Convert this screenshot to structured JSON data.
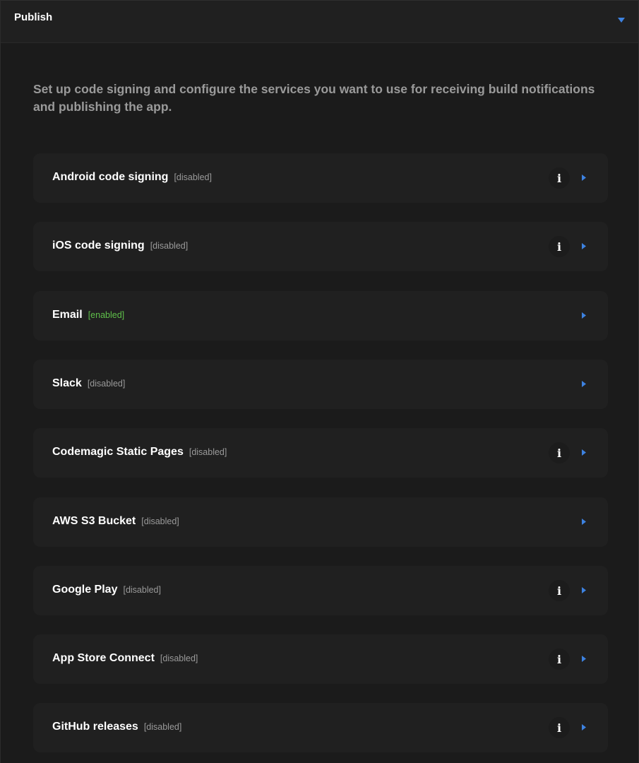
{
  "header": {
    "title": "Publish",
    "toggle_icon": "caret-down-icon",
    "accent_color": "#3d82e0"
  },
  "description": "Set up code signing and configure the services you want to use for receiving build notifications and publishing the app.",
  "colors": {
    "enabled": "#5fc04a",
    "disabled": "#9a9a9a",
    "arrow": "#3d82e0"
  },
  "items": [
    {
      "name": "Android code signing",
      "status": "[disabled]",
      "enabled": false,
      "has_info": true
    },
    {
      "name": "iOS code signing",
      "status": "[disabled]",
      "enabled": false,
      "has_info": true
    },
    {
      "name": "Email",
      "status": "[enabled]",
      "enabled": true,
      "has_info": false
    },
    {
      "name": "Slack",
      "status": "[disabled]",
      "enabled": false,
      "has_info": false
    },
    {
      "name": "Codemagic Static Pages",
      "status": "[disabled]",
      "enabled": false,
      "has_info": true
    },
    {
      "name": "AWS S3 Bucket",
      "status": "[disabled]",
      "enabled": false,
      "has_info": false
    },
    {
      "name": "Google Play",
      "status": "[disabled]",
      "enabled": false,
      "has_info": true
    },
    {
      "name": "App Store Connect",
      "status": "[disabled]",
      "enabled": false,
      "has_info": true
    },
    {
      "name": "GitHub releases",
      "status": "[disabled]",
      "enabled": false,
      "has_info": true
    }
  ],
  "info_glyph": "i"
}
